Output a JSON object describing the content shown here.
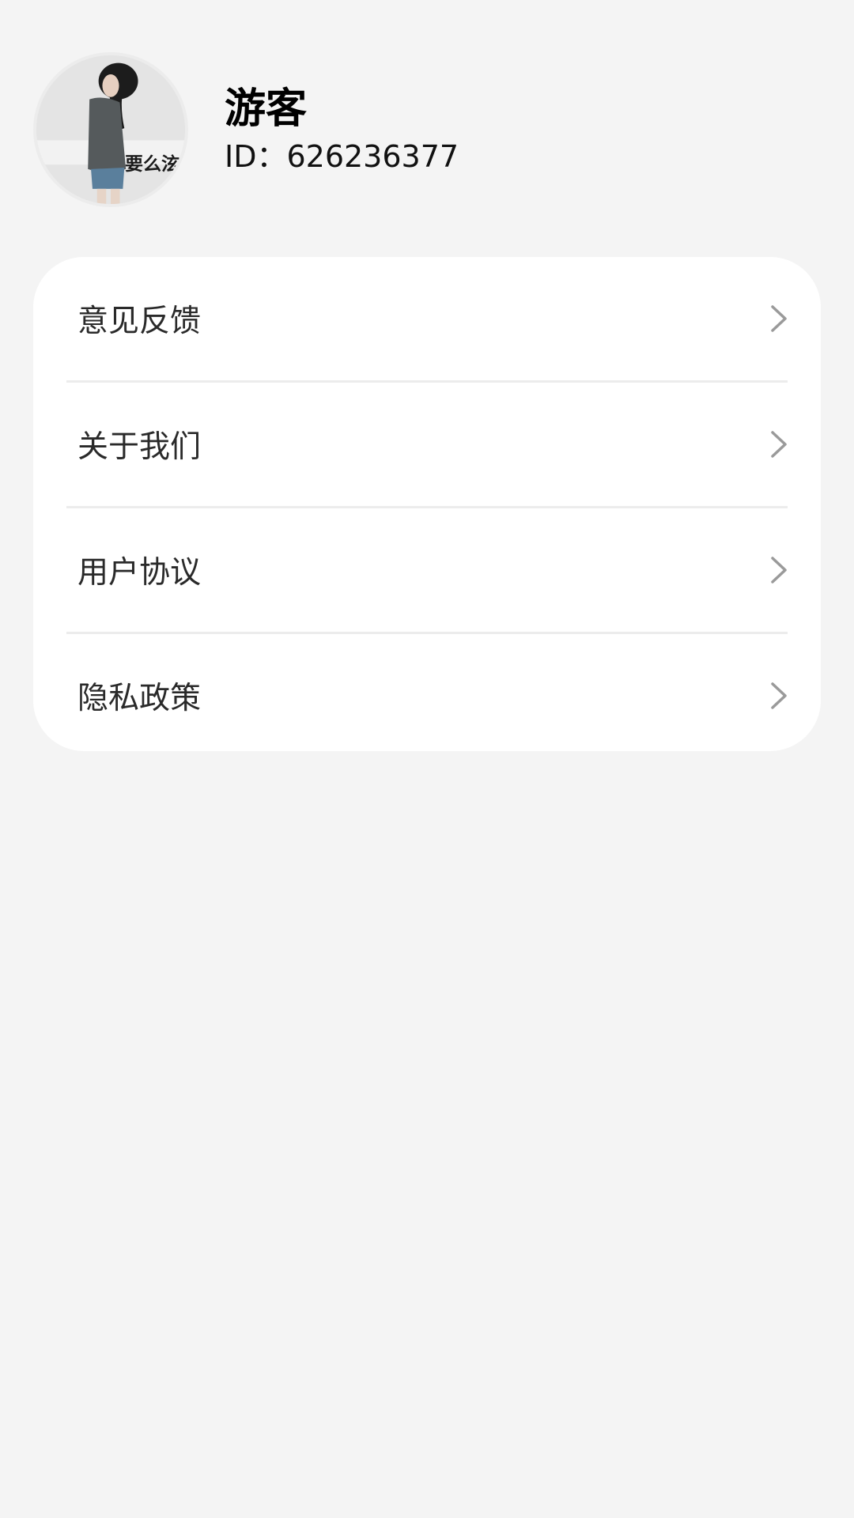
{
  "profile": {
    "avatar_caption": "要么泫",
    "username": "游客",
    "id_label": "ID：",
    "id_value": "626236377"
  },
  "menu": {
    "items": [
      {
        "label": "意见反馈",
        "icon": "chevron-right-icon"
      },
      {
        "label": "关于我们",
        "icon": "chevron-right-icon"
      },
      {
        "label": "用户协议",
        "icon": "chevron-right-icon"
      },
      {
        "label": "隐私政策",
        "icon": "chevron-right-icon"
      }
    ]
  },
  "colors": {
    "page_background": "#f4f4f4",
    "card_background": "#ffffff",
    "divider": "#ececec",
    "chevron": "#9a9a9a"
  }
}
